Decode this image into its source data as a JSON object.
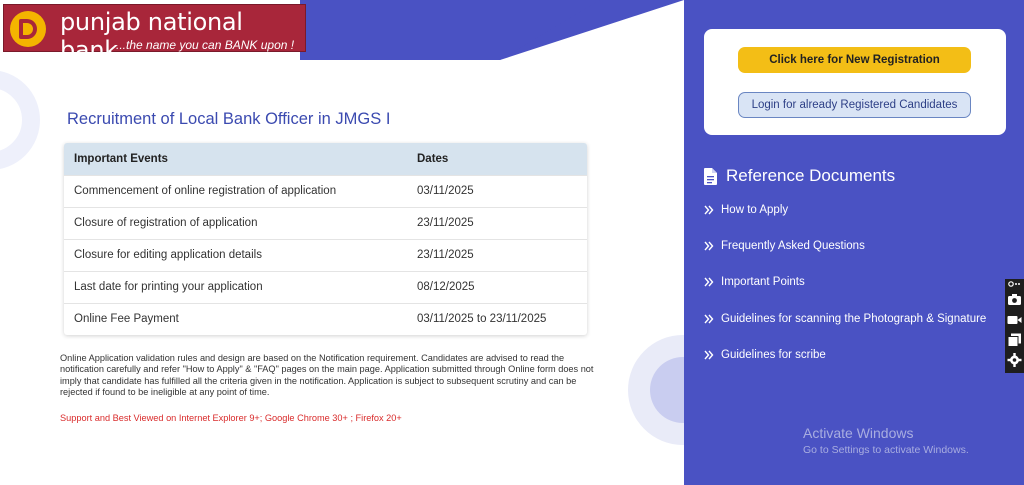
{
  "brand": {
    "name": "punjab national bank",
    "tagline": "...the name you can BANK upon !",
    "colors": {
      "maroon": "#a8263a",
      "gold": "#f4b400"
    }
  },
  "main": {
    "title": "Recruitment of Local Bank Officer in JMGS I",
    "table": {
      "headers": [
        "Important Events",
        "Dates"
      ],
      "rows": [
        [
          "Commencement of online registration of application",
          "03/11/2025"
        ],
        [
          "Closure of registration of application",
          "23/11/2025"
        ],
        [
          "Closure for editing application details",
          "23/11/2025"
        ],
        [
          "Last date for printing your application",
          "08/12/2025"
        ],
        [
          "Online Fee Payment",
          "03/11/2025 to 23/11/2025"
        ]
      ]
    },
    "notice": "Online Application validation rules and design are based on the Notification requirement. Candidates are advised to read the notification carefully and refer \"How to Apply\" & \"FAQ\" pages on the main page. Application submitted through Online form does not imply that candidate has fulfilled all the criteria given in the notification. Application is subject to subsequent scrutiny and can be rejected if found to be ineligible at any point of time.",
    "support": "Support and Best Viewed on Internet Explorer 9+; Google Chrome 30+ ; Firefox 20+"
  },
  "sidebar": {
    "new_registration": "Click here for New Registration",
    "login": "Login for already Registered Candidates",
    "ref_heading": "Reference Documents",
    "ref_icon": "document-icon",
    "links": [
      "How to Apply",
      "Frequently Asked Questions",
      "Important Points",
      "Guidelines for scanning the Photograph & Signature",
      "Guidelines for scribe"
    ],
    "colors": {
      "panel": "#4a52c3",
      "primary_button": "#f3be16"
    }
  },
  "watermark": {
    "title": "Activate Windows",
    "subtitle": "Go to Settings to activate Windows."
  },
  "toolbar": {
    "icons": [
      "camera-icon",
      "video-icon",
      "copy-icon",
      "settings-icon"
    ]
  }
}
